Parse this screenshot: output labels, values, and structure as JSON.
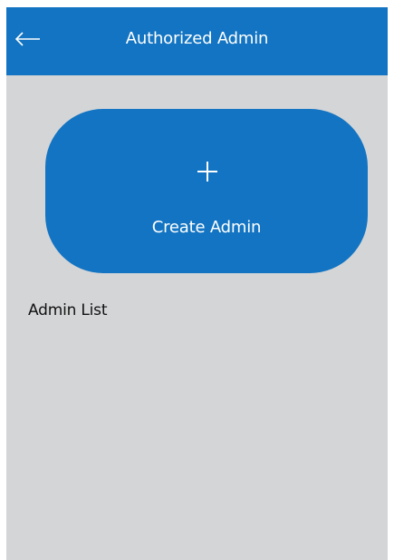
{
  "header": {
    "title": "Authorized Admin",
    "back_icon": "arrow-left-icon"
  },
  "create_button": {
    "label": "Create Admin",
    "icon": "plus-icon"
  },
  "admin_list": {
    "title": "Admin List",
    "items": []
  },
  "colors": {
    "primary": "#1274c2",
    "background": "#d4d5d7",
    "text_on_primary": "#ffffff",
    "text": "#111111"
  }
}
